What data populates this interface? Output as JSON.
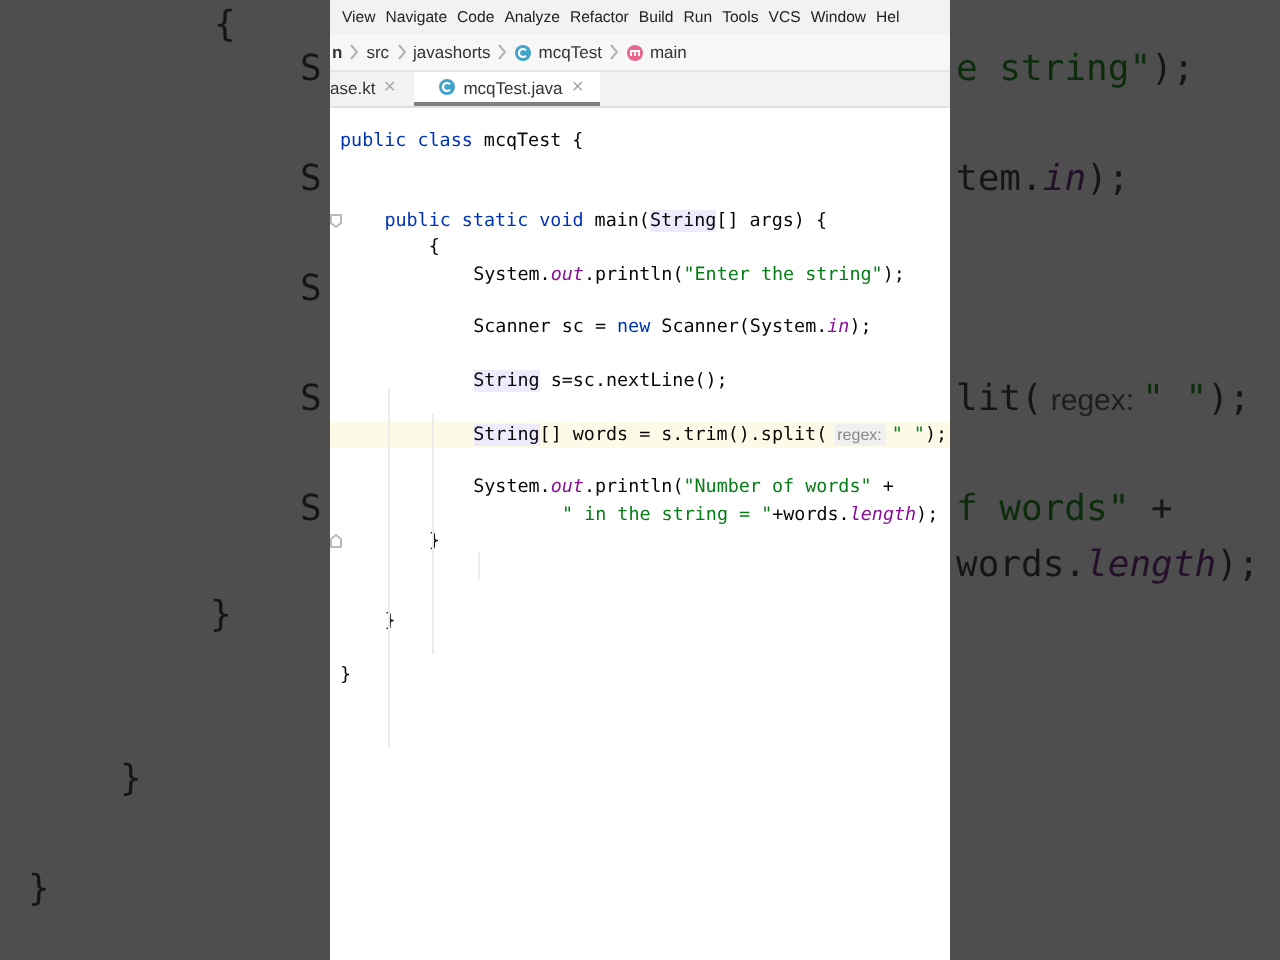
{
  "backdrop_left": {
    "lines": [
      {
        "tokens": [
          {
            "kind": "plain",
            "text": "{"
          }
        ]
      },
      {
        "tokens": [
          {
            "kind": "plain",
            "text": "S"
          }
        ]
      },
      {
        "tokens": [
          {
            "kind": "plain",
            "text": "S"
          }
        ]
      },
      {
        "tokens": [
          {
            "kind": "plain",
            "text": "S"
          }
        ]
      },
      {
        "tokens": [
          {
            "kind": "plain",
            "text": "S"
          }
        ]
      },
      {
        "tokens": [
          {
            "kind": "plain",
            "text": "S"
          }
        ]
      },
      {
        "tokens": [
          {
            "kind": "plain",
            "text": "}"
          }
        ]
      },
      {
        "tokens": [
          {
            "kind": "plain",
            "text": "}"
          }
        ]
      },
      {
        "tokens": [
          {
            "kind": "plain",
            "text": "}"
          }
        ]
      }
    ]
  },
  "menu_bar": [
    "View",
    "Navigate",
    "Code",
    "Analyze",
    "Refactor",
    "Build",
    "Run",
    "Tools",
    "VCS",
    "Window",
    "Hel"
  ],
  "breadcrumbs": [
    {
      "label": "n",
      "kind": "plain"
    },
    {
      "label": "src",
      "kind": "plain"
    },
    {
      "label": "javashorts",
      "kind": "plain"
    },
    {
      "label": "mcqTest",
      "kind": "class"
    },
    {
      "label": "main",
      "kind": "method"
    }
  ],
  "tabs": [
    {
      "label": "ase.kt",
      "kind": "plain",
      "selected": false,
      "close": "✕"
    },
    {
      "label": "mcqTest.java",
      "kind": "class",
      "selected": true,
      "close": "✕"
    }
  ],
  "editor": {
    "lines": [
      {
        "tokens": [
          {
            "kind": "keyword",
            "text": "public class "
          },
          {
            "kind": "plain",
            "text": "mcqTest {"
          }
        ]
      },
      {
        "tokens": [
          {
            "kind": "keyword",
            "text": "public static void "
          },
          {
            "kind": "plain",
            "text": "main("
          },
          {
            "kind": "usage",
            "text": "String"
          },
          {
            "kind": "plain",
            "text": "[] args) {"
          }
        ]
      },
      {
        "tokens": [
          {
            "kind": "plain",
            "text": "{"
          }
        ]
      },
      {
        "tokens": [
          {
            "kind": "plain",
            "text": "System."
          },
          {
            "kind": "field",
            "text": "out"
          },
          {
            "kind": "plain",
            "text": ".println("
          },
          {
            "kind": "string",
            "text": "\"Enter the string\""
          },
          {
            "kind": "plain",
            "text": ");"
          }
        ]
      },
      {
        "tokens": [
          {
            "kind": "plain",
            "text": "Scanner sc = "
          },
          {
            "kind": "keyword",
            "text": "new "
          },
          {
            "kind": "plain",
            "text": "Scanner(System."
          },
          {
            "kind": "field",
            "text": "in"
          },
          {
            "kind": "plain",
            "text": ");"
          }
        ]
      },
      {
        "tokens": [
          {
            "kind": "usage",
            "text": "String"
          },
          {
            "kind": "plain",
            "text": " s=sc.nextLine();"
          }
        ]
      },
      {
        "current": true,
        "tokens": [
          {
            "kind": "usage",
            "text": "String"
          },
          {
            "kind": "plain",
            "text": "[] words = s.trim().split("
          },
          {
            "kind": "hint",
            "text": "regex:"
          },
          {
            "kind": "string",
            "text": "\" \""
          },
          {
            "kind": "plain",
            "text": ");"
          }
        ]
      },
      {
        "tokens": [
          {
            "kind": "plain",
            "text": "System."
          },
          {
            "kind": "field",
            "text": "out"
          },
          {
            "kind": "plain",
            "text": ".println("
          },
          {
            "kind": "string",
            "text": "\"Number of words\""
          },
          {
            "kind": "plain",
            "text": " +"
          }
        ]
      },
      {
        "tokens": [
          {
            "kind": "string",
            "text": "\" in the string = \""
          },
          {
            "kind": "plain",
            "text": "+words."
          },
          {
            "kind": "field",
            "text": "length"
          },
          {
            "kind": "plain",
            "text": ");"
          }
        ]
      },
      {
        "tokens": [
          {
            "kind": "plain",
            "text": "}"
          }
        ]
      },
      {
        "tokens": [
          {
            "kind": "plain",
            "text": "}"
          }
        ]
      },
      {
        "tokens": [
          {
            "kind": "plain",
            "text": "}"
          }
        ]
      }
    ]
  },
  "backdrop_right": {
    "lines": [
      {
        "tokens": [
          {
            "kind": "string",
            "text": "e string\""
          },
          {
            "kind": "plain",
            "text": ");"
          }
        ]
      },
      {
        "tokens": [
          {
            "kind": "plain",
            "text": "tem."
          },
          {
            "kind": "field",
            "text": "in"
          },
          {
            "kind": "plain",
            "text": ");"
          }
        ]
      },
      {
        "tokens": [
          {
            "kind": "plain",
            "text": "lit("
          },
          {
            "kind": "hint",
            "text": "regex:"
          },
          {
            "kind": "string",
            "text": "\" \""
          },
          {
            "kind": "plain",
            "text": ");"
          }
        ]
      },
      {
        "tokens": [
          {
            "kind": "string",
            "text": "f words\""
          },
          {
            "kind": "plain",
            "text": " +"
          }
        ]
      },
      {
        "tokens": [
          {
            "kind": "plain",
            "text": "words."
          },
          {
            "kind": "field",
            "text": "length"
          },
          {
            "kind": "plain",
            "text": ");"
          }
        ]
      }
    ]
  }
}
